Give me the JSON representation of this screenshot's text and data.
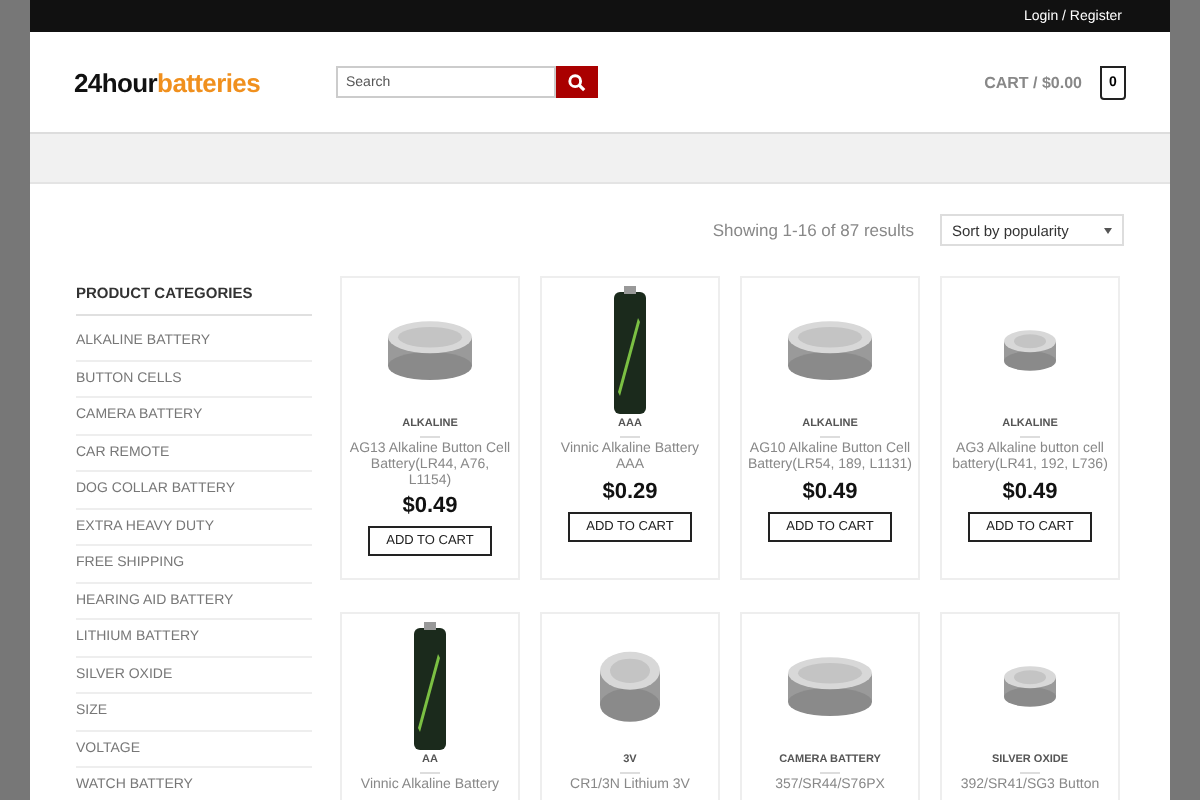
{
  "top_bar": {
    "account_link": "Login / Register"
  },
  "header": {
    "logo": {
      "prefix": "24hour",
      "suffix": "batteries"
    },
    "search": {
      "placeholder": "Search"
    },
    "cart": {
      "label": "CART / $0.00",
      "count": "0"
    }
  },
  "toolbar": {
    "result_count": "Showing 1-16 of 87 results",
    "sort": {
      "value": "Sort by popularity"
    }
  },
  "sidebar": {
    "title": "PRODUCT CATEGORIES",
    "items": [
      "ALKALINE BATTERY",
      "BUTTON CELLS",
      "CAMERA BATTERY",
      "CAR REMOTE",
      "DOG COLLAR BATTERY",
      "EXTRA HEAVY DUTY",
      "FREE SHIPPING",
      "HEARING AID BATTERY",
      "LITHIUM BATTERY",
      "SILVER OXIDE",
      "SIZE",
      "VOLTAGE",
      "WATCH BATTERY"
    ]
  },
  "products": [
    {
      "kind": "coin",
      "category": "ALKALINE",
      "title": "AG13 Alkaline Button Cell Battery(LR44, A76, L1154)",
      "price": "$0.49",
      "button": "ADD TO CART"
    },
    {
      "kind": "cylinder",
      "category": "AAA",
      "title": "Vinnic Alkaline Battery AAA",
      "price": "$0.29",
      "button": "ADD TO CART"
    },
    {
      "kind": "coin",
      "category": "ALKALINE",
      "title": "AG10 Alkaline Button Cell Battery(LR54, 189, L1131)",
      "price": "$0.49",
      "button": "ADD TO CART"
    },
    {
      "kind": "small-coin",
      "category": "ALKALINE",
      "title": "AG3 Alkaline button cell battery(LR41, 192, L736)",
      "price": "$0.49",
      "button": "ADD TO CART"
    },
    {
      "kind": "cylinder",
      "category": "AA",
      "title": "Vinnic Alkaline Battery"
    },
    {
      "kind": "tall-coin",
      "category": "3V",
      "title": "CR1/3N Lithium 3V"
    },
    {
      "kind": "coin",
      "category": "CAMERA BATTERY",
      "title": "357/SR44/S76PX"
    },
    {
      "kind": "small-coin",
      "category": "SILVER OXIDE",
      "title": "392/SR41/SG3 Button"
    }
  ]
}
